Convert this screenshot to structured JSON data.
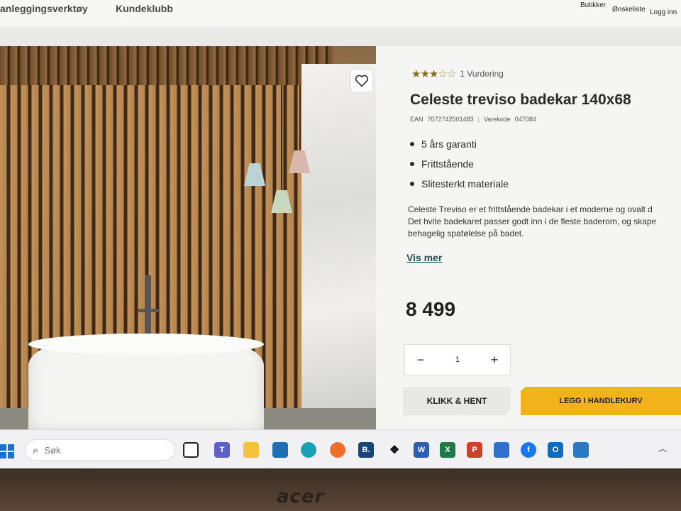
{
  "nav": {
    "link1": "anleggingsverktøy",
    "link2": "Kundeklubb",
    "butikker": "Butikker",
    "onskeliste": "Ønskeliste",
    "logg_inn": "Logg inn"
  },
  "product": {
    "rating_stars": 3,
    "rating_max": 5,
    "rating_count_text": "1 Vurdering",
    "title": "Celeste treviso badekar 140x68",
    "ean_label": "EAN",
    "ean_value": "7072742501483",
    "varekode_label": "Varekode",
    "varekode_value": "047084",
    "features": [
      "5 års garanti",
      "Frittstående",
      "Slitesterkt materiale"
    ],
    "description_line1": "Celeste Treviso er et frittstående badekar i et moderne og ovalt d",
    "description_line2": "Det hvite badekaret passer godt inn i de fleste baderom, og skape",
    "description_line3": "behagelig spafølelse på badet.",
    "vis_mer": "Vis mer",
    "price": "8 499",
    "quantity": "1",
    "qty_minus": "−",
    "qty_plus": "+",
    "btn_hent": "KLIKK & HENT",
    "btn_kurv": "LEGG I HANDLEKURV"
  },
  "taskbar": {
    "search_placeholder": "Søk",
    "icons": [
      "task-view",
      "teams",
      "file-explorer",
      "store",
      "edge",
      "firefox",
      "b-app",
      "dropbox",
      "word",
      "excel",
      "powerpoint",
      "snipping",
      "facebook",
      "outlook",
      "remote"
    ]
  },
  "brand": "acer",
  "colors": {
    "accent": "#f2b21a",
    "link": "#1e4f56",
    "star": "#8a6d1a"
  }
}
